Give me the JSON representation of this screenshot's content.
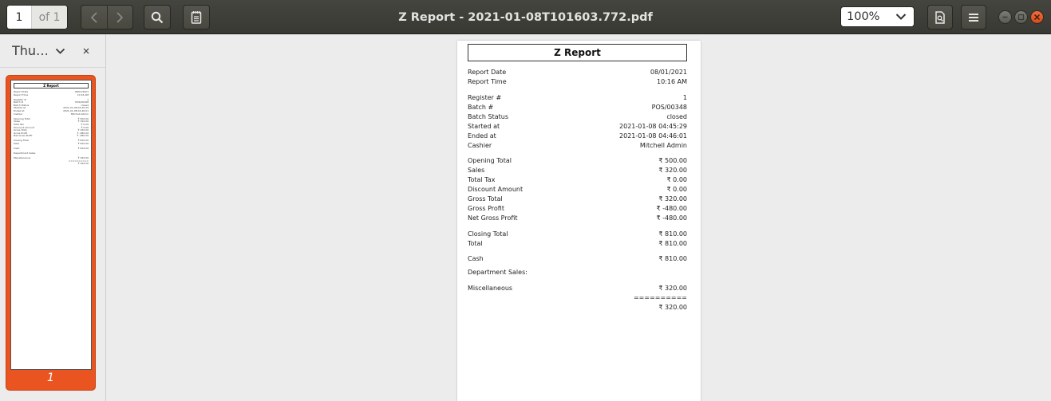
{
  "window": {
    "title": "Z Report - 2021-01-08T101603.772.pdf",
    "page_current": "1",
    "page_total": "of 1",
    "zoom": "100%"
  },
  "sidebar": {
    "title": "Thu…",
    "thumb_label": "1"
  },
  "report": {
    "title": "Z Report",
    "header_rows": [
      {
        "label": "Report Date",
        "value": "08/01/2021"
      },
      {
        "label": "Report Time",
        "value": "10:16 AM"
      }
    ],
    "info_rows": [
      {
        "label": "Register #",
        "value": "1"
      },
      {
        "label": "Batch #",
        "value": "POS/00348"
      },
      {
        "label": "Batch Status",
        "value": "closed"
      },
      {
        "label": "Started at",
        "value": "2021-01-08 04:45:29"
      },
      {
        "label": "Ended at",
        "value": "2021-01-08 04:46:01"
      },
      {
        "label": "Cashier",
        "value": "Mitchell Admin"
      }
    ],
    "totals_rows": [
      {
        "label": "Opening Total",
        "value": "₹ 500.00"
      },
      {
        "label": "Sales",
        "value": "₹ 320.00"
      },
      {
        "label": "Total Tax",
        "value": "₹ 0.00"
      },
      {
        "label": "Discount Amount",
        "value": "₹ 0.00"
      },
      {
        "label": "Gross Total",
        "value": "₹ 320.00"
      },
      {
        "label": "Gross Profit",
        "value": "₹ -480.00"
      },
      {
        "label": "Net Gross Profit",
        "value": "₹ -480.00"
      }
    ],
    "closing_rows": [
      {
        "label": "Closing Total",
        "value": "₹ 810.00"
      },
      {
        "label": "Total",
        "value": "₹ 810.00"
      }
    ],
    "cash_row": {
      "label": "Cash",
      "value": "₹ 810.00"
    },
    "department_heading": "Department Sales:",
    "department_row": {
      "label": "Miscellaneous",
      "value": "₹ 320.00"
    },
    "separator": "==========",
    "department_total": "₹ 320.00"
  },
  "colors": {
    "accent": "#e95420",
    "headerbar": "#3f3f3a"
  }
}
